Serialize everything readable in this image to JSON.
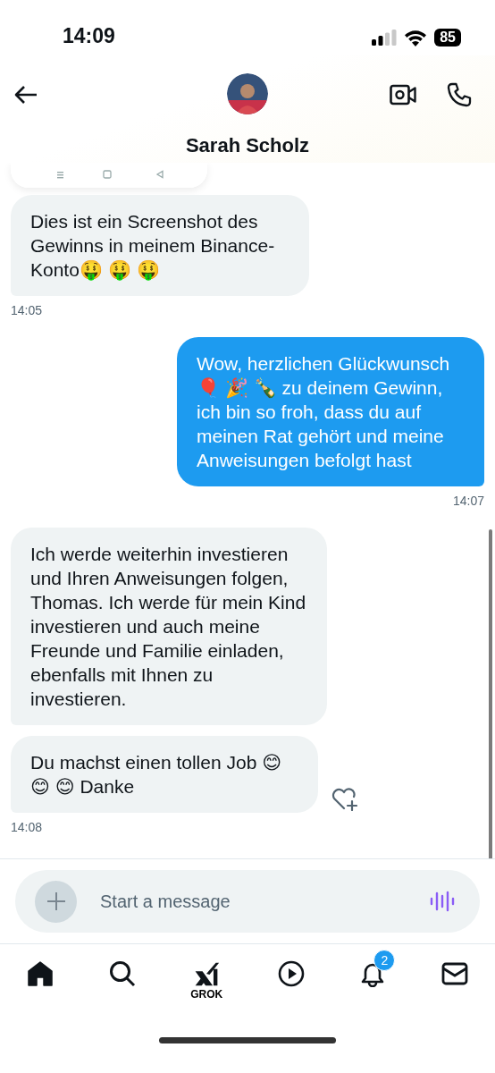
{
  "status_bar": {
    "time": "14:09",
    "battery": "85"
  },
  "header": {
    "contact_name": "Sarah Scholz"
  },
  "messages": [
    {
      "kind": "image"
    },
    {
      "kind": "received",
      "text": "Dies ist ein Screenshot des Gewinns in meinem Binance-Konto🤑 🤑 🤑",
      "time": "14:05"
    },
    {
      "kind": "sent",
      "text": "Wow, herzlichen Glückwunsch 🎈 🎉 🍾 zu deinem Gewinn, ich bin so froh, dass du auf meinen Rat gehört und meine Anweisungen befolgt hast",
      "time": "14:07"
    },
    {
      "kind": "received",
      "text": "Ich werde weiterhin investieren und Ihren Anweisungen folgen, Thomas. Ich werde für mein Kind investieren und auch meine Freunde und Familie einladen, ebenfalls mit Ihnen zu investieren."
    },
    {
      "kind": "received",
      "text": "Du machst einen tollen Job 😊 😊 😊 Danke",
      "time": "14:08",
      "reaction_button": true
    }
  ],
  "composer": {
    "placeholder": "Start a message"
  },
  "tab_bar": [
    {
      "kind": "home",
      "selected": true
    },
    {
      "kind": "search",
      "selected": false
    },
    {
      "kind": "grok",
      "label": "GROK",
      "selected": false
    },
    {
      "kind": "video",
      "selected": false
    },
    {
      "kind": "notifications",
      "badge": "2",
      "selected": false
    },
    {
      "kind": "messages",
      "selected": false
    }
  ]
}
